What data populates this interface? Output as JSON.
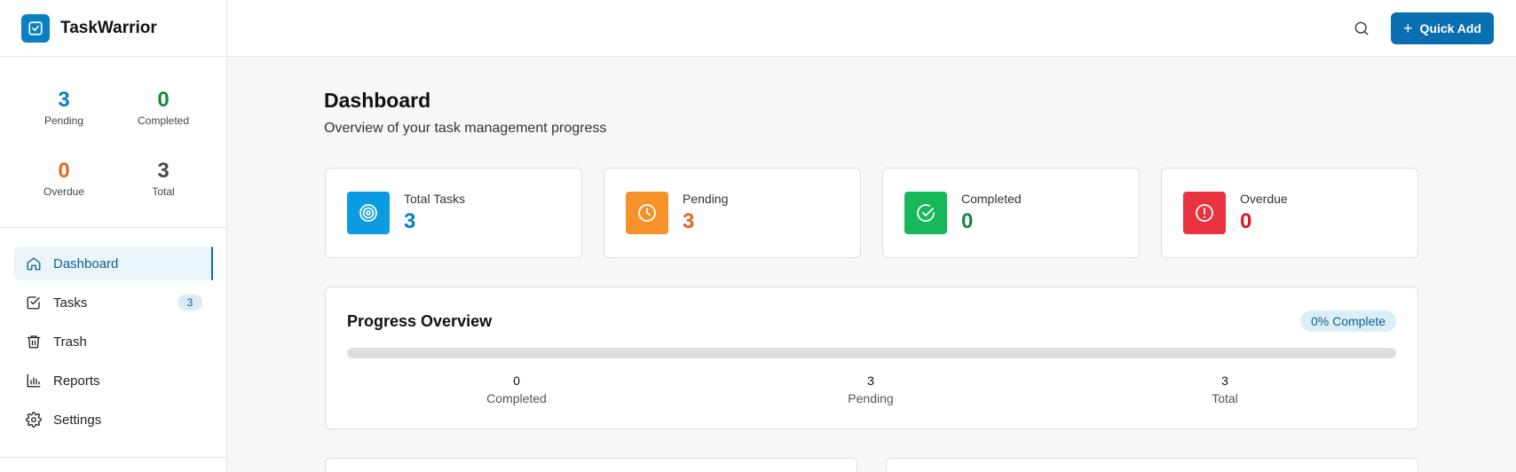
{
  "brand": {
    "name": "TaskWarrior"
  },
  "sidebar_stats": {
    "pending": {
      "value": "3",
      "label": "Pending"
    },
    "completed": {
      "value": "0",
      "label": "Completed"
    },
    "overdue": {
      "value": "0",
      "label": "Overdue"
    },
    "total": {
      "value": "3",
      "label": "Total"
    }
  },
  "nav": [
    {
      "label": "Dashboard",
      "icon": "home-icon",
      "active": true
    },
    {
      "label": "Tasks",
      "icon": "checkbox-icon",
      "badge": "3"
    },
    {
      "label": "Trash",
      "icon": "trash-icon"
    },
    {
      "label": "Reports",
      "icon": "bar-chart-icon"
    },
    {
      "label": "Settings",
      "icon": "gear-icon"
    }
  ],
  "topbar": {
    "quick_add_label": "Quick Add"
  },
  "page": {
    "title": "Dashboard",
    "subtitle": "Overview of your task management progress"
  },
  "cards": [
    {
      "label": "Total Tasks",
      "value": "3",
      "color": "#0a7fc2",
      "icon_bg": "#0a9be0",
      "icon": "target-icon"
    },
    {
      "label": "Pending",
      "value": "3",
      "color": "#e06a1a",
      "icon_bg": "#f5922a",
      "icon": "clock-icon"
    },
    {
      "label": "Completed",
      "value": "0",
      "color": "#138a3d",
      "icon_bg": "#17b85a",
      "icon": "check-circle-icon"
    },
    {
      "label": "Overdue",
      "value": "0",
      "color": "#d81b2a",
      "icon_bg": "#ea3340",
      "icon": "alert-circle-icon"
    }
  ],
  "progress": {
    "title": "Progress Overview",
    "badge": "0% Complete",
    "percent": 0,
    "stats": [
      {
        "value": "0",
        "label": "Completed"
      },
      {
        "value": "3",
        "label": "Pending"
      },
      {
        "value": "3",
        "label": "Total"
      }
    ]
  }
}
